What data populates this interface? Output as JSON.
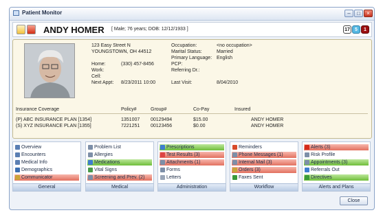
{
  "window": {
    "title": "Patient Monitor"
  },
  "header": {
    "patient_name": "ANDY HOMER",
    "patient_info": "[ Male; 76 years; DOB: 12/12/1933 ]",
    "counters": [
      "17",
      "5",
      "1"
    ]
  },
  "details": {
    "address_line1": "123 Easy Street N",
    "address_line2": "YOUNGSTOWN, OH 44512",
    "home_label": "Home:",
    "home_value": "(330) 457-8456",
    "work_label": "Work:",
    "cell_label": "Cell:",
    "next_appt_label": "Next Appt:",
    "next_appt_value": "8/23/2011 10:00",
    "occupation_label": "Occupation:",
    "occupation_value": "<no occupation>",
    "marital_label": "Marital Status:",
    "marital_value": "Married",
    "language_label": "Primary Language:",
    "language_value": "English",
    "pcp_label": "PCP:",
    "referring_label": "Referring Dr.:",
    "last_visit_label": "Last Visit:",
    "last_visit_value": "8/04/2010"
  },
  "insurance": {
    "headers": [
      "Insurance Coverage",
      "Policy#",
      "Group#",
      "Co-Pay",
      "Insured"
    ],
    "rows": [
      [
        "(P) ABC INSURANCE PLAN [1354]",
        "1351007",
        "00129494",
        "$15.00",
        "ANDY HOMER"
      ],
      [
        "(S) XYZ INSURANCE PLAN [1355]",
        "7221251",
        "00123456",
        "$0.00",
        "ANDY HOMER"
      ]
    ]
  },
  "panels": [
    {
      "footer": "General",
      "items": [
        {
          "label": "Overview",
          "style": "plain",
          "icon": "overview-icon",
          "color": "#5a7fb3"
        },
        {
          "label": "Encounters",
          "style": "plain",
          "icon": "encounters-icon",
          "color": "#5a7fb3"
        },
        {
          "label": "Medical Info",
          "style": "plain",
          "icon": "medical-info-icon",
          "color": "#5a7fb3"
        },
        {
          "label": "Demographics",
          "style": "plain",
          "icon": "demographics-icon",
          "color": "#3b6fb2"
        },
        {
          "label": "Communicator",
          "style": "red",
          "icon": "communicator-icon",
          "color": "#c9a43a"
        }
      ]
    },
    {
      "footer": "Medical",
      "items": [
        {
          "label": "Problem List",
          "style": "plain",
          "icon": "problem-list-icon",
          "color": "#7d8fa8"
        },
        {
          "label": "Allergies",
          "style": "plain",
          "icon": "allergies-icon",
          "color": "#7d8fa8"
        },
        {
          "label": "Medications",
          "style": "green",
          "icon": "medications-icon",
          "color": "#3f7ed0"
        },
        {
          "label": "Vital Signs",
          "style": "plain",
          "icon": "vital-signs-icon",
          "color": "#4a9a4a"
        },
        {
          "label": "Screening and Prev. (2)",
          "style": "red",
          "icon": "screening-icon",
          "color": "#7d8fa8"
        }
      ]
    },
    {
      "footer": "Administration",
      "items": [
        {
          "label": "Prescriptions",
          "style": "green",
          "icon": "prescriptions-icon",
          "color": "#3f7ed0"
        },
        {
          "label": "Test Results (3)",
          "style": "red",
          "icon": "test-results-icon",
          "color": "#d44"
        },
        {
          "label": "Attachments (1)",
          "style": "red",
          "icon": "attachments-icon",
          "color": "#7d8fa8"
        },
        {
          "label": "Forms",
          "style": "plain",
          "icon": "forms-icon",
          "color": "#7d8fa8"
        },
        {
          "label": "Letters",
          "style": "plain",
          "icon": "letters-icon",
          "color": "#9aa6b8"
        }
      ]
    },
    {
      "footer": "Workflow",
      "items": [
        {
          "label": "Reminders",
          "style": "plain",
          "icon": "reminders-icon",
          "color": "#d84a2a"
        },
        {
          "label": "Phone Messages (1)",
          "style": "red",
          "icon": "phone-messages-icon",
          "color": "#7d8fa8"
        },
        {
          "label": "Internal Mail (3)",
          "style": "red",
          "icon": "internal-mail-icon",
          "color": "#7d8fa8"
        },
        {
          "label": "Orders (3)",
          "style": "red",
          "icon": "orders-icon",
          "color": "#c9a43a"
        },
        {
          "label": "Faxes Sent",
          "style": "plain",
          "icon": "faxes-sent-icon",
          "color": "#3a9a3a"
        }
      ]
    },
    {
      "footer": "Alerts and Plans",
      "items": [
        {
          "label": "Alerts (3)",
          "style": "red",
          "icon": "alerts-icon",
          "color": "#d42a1a"
        },
        {
          "label": "Risk Profile",
          "style": "plain",
          "icon": "risk-profile-icon",
          "color": "#7d8fa8"
        },
        {
          "label": "Appointments (3)",
          "style": "green",
          "icon": "appointments-icon",
          "color": "#7d8fa8"
        },
        {
          "label": "Referrals Out",
          "style": "plain",
          "icon": "referrals-out-icon",
          "color": "#3f7ed0"
        },
        {
          "label": "Directives",
          "style": "green",
          "icon": "directives-icon",
          "color": "#3a9a3a"
        }
      ]
    }
  ],
  "footer": {
    "close_label": "Close"
  }
}
